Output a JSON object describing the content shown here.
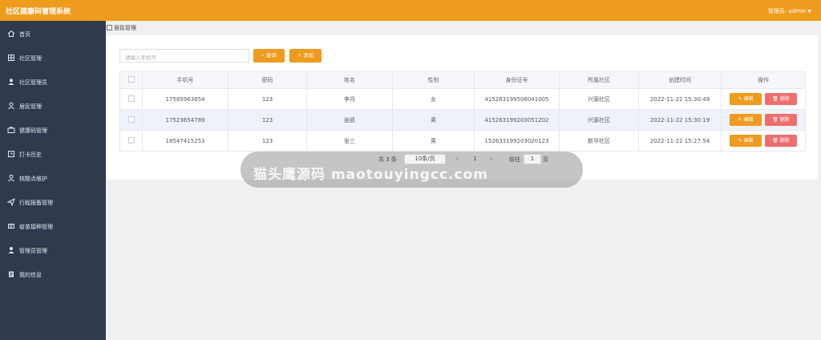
{
  "header": {
    "app_title": "社区健康码管理系统",
    "admin_label": "管理员: admin",
    "caret": "▼"
  },
  "sidebar": {
    "items": [
      {
        "label": "首页",
        "icon": "home-icon"
      },
      {
        "label": "社区管理",
        "icon": "grid-icon"
      },
      {
        "label": "社区管理员",
        "icon": "user-group-icon"
      },
      {
        "label": "居民管理",
        "icon": "person-icon"
      },
      {
        "label": "健康码管理",
        "icon": "briefcase-icon"
      },
      {
        "label": "打卡历史",
        "icon": "history-icon"
      },
      {
        "label": "核酸点维护",
        "icon": "location-user-icon"
      },
      {
        "label": "行程报备管理",
        "icon": "send-icon"
      },
      {
        "label": "疫苗接种管理",
        "icon": "syringe-icon"
      },
      {
        "label": "管理员管理",
        "icon": "admin-icon"
      },
      {
        "label": "我的信息",
        "icon": "document-icon"
      }
    ]
  },
  "breadcrumb": {
    "label": "居民管理"
  },
  "toolbar": {
    "search_placeholder": "请输入手机号",
    "query_label": "查询",
    "add_label": "添加",
    "query_icon": "search-icon",
    "add_icon": "plus-icon"
  },
  "table": {
    "headers": [
      "",
      "手机号",
      "密码",
      "姓名",
      "性别",
      "身份证号",
      "所属社区",
      "创建时间",
      "操作"
    ],
    "rows": [
      {
        "phone": "17585963654",
        "password": "123",
        "name": "李月",
        "gender": "女",
        "id_card": "415263199506041005",
        "community": "兴源社区",
        "created": "2022-11-22 15:30:49"
      },
      {
        "phone": "17523654789",
        "password": "123",
        "name": "张凯",
        "gender": "男",
        "id_card": "415263199203051202",
        "community": "兴源社区",
        "created": "2022-11-22 15:30:19"
      },
      {
        "phone": "18547415253",
        "password": "123",
        "name": "张三",
        "gender": "男",
        "id_card": "152633199203020123",
        "community": "新华社区",
        "created": "2022-11-22 15:27:54"
      }
    ],
    "edit_label": "编辑",
    "delete_label": "删除"
  },
  "pagination": {
    "total": "共 3 条",
    "page_size": "10条/页",
    "prev": "‹",
    "current_page": "1",
    "next": "›",
    "goto_label": "前往",
    "goto_value": "1",
    "page_suffix": "页"
  },
  "watermark": {
    "text": "猫头鹰源码  maotouyingcc.com"
  },
  "colors": {
    "header_bg": "#ef9b1d",
    "sidebar_bg": "#2f3a4f",
    "primary": "#ef9b1d",
    "danger": "#ee6e6e"
  }
}
